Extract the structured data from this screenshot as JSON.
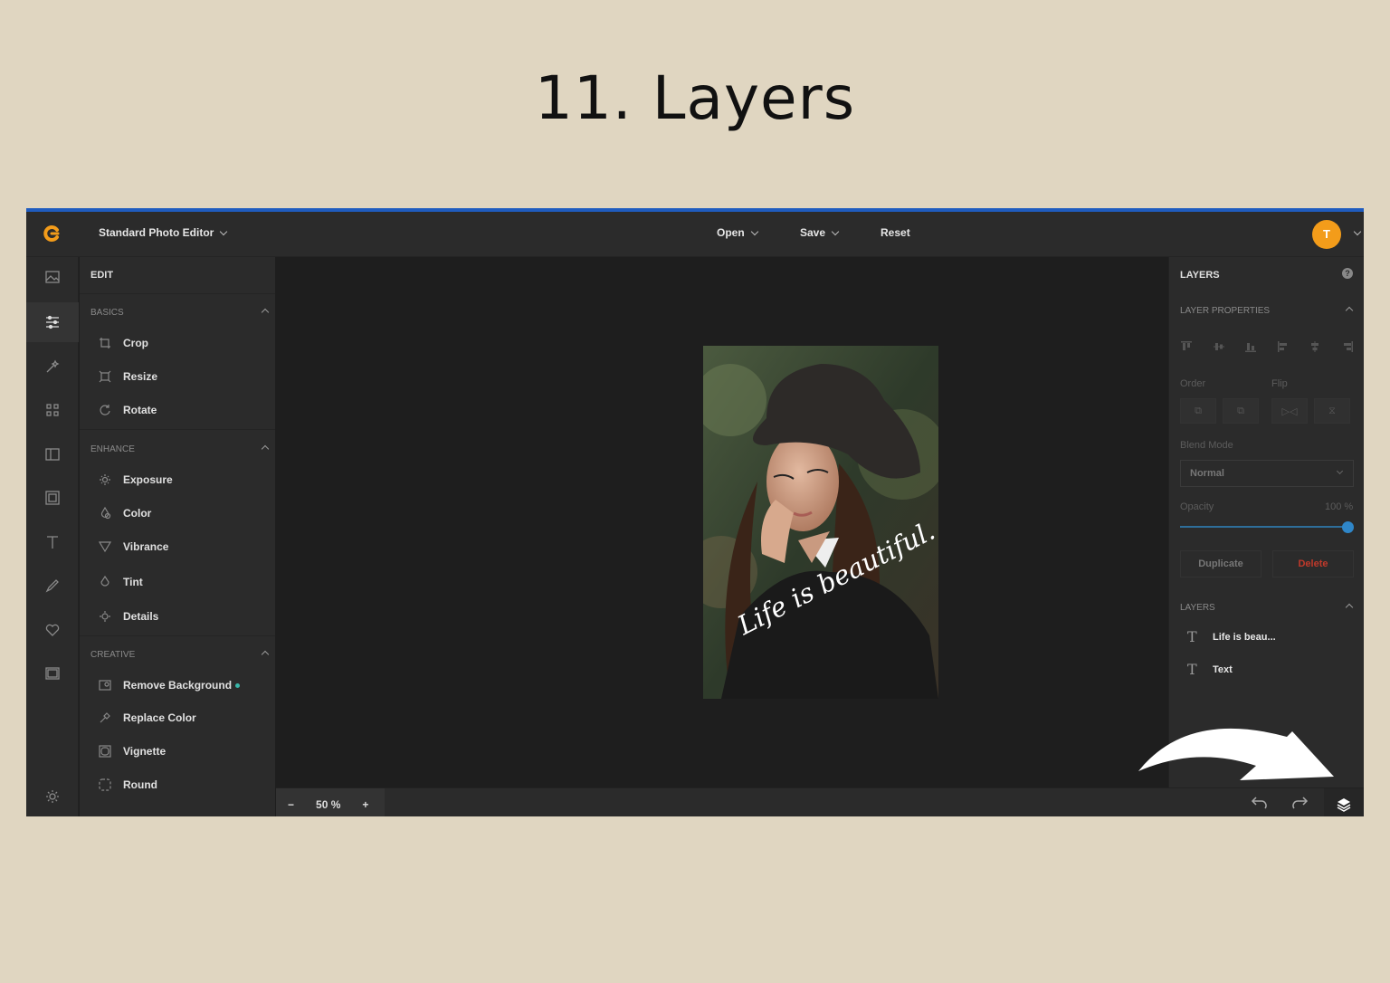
{
  "heading": "11. Layers",
  "topbar": {
    "app_title": "Standard Photo Editor",
    "menu": [
      {
        "label": "Open"
      },
      {
        "label": "Save"
      },
      {
        "label": "Reset"
      }
    ],
    "avatar_initial": "T"
  },
  "left_panel": {
    "title": "EDIT",
    "sections": [
      {
        "title": "BASICS",
        "items": [
          {
            "label": "Crop",
            "icon": "crop-icon"
          },
          {
            "label": "Resize",
            "icon": "resize-icon"
          },
          {
            "label": "Rotate",
            "icon": "rotate-icon"
          }
        ]
      },
      {
        "title": "ENHANCE",
        "items": [
          {
            "label": "Exposure",
            "icon": "exposure-icon"
          },
          {
            "label": "Color",
            "icon": "color-icon"
          },
          {
            "label": "Vibrance",
            "icon": "vibrance-icon"
          },
          {
            "label": "Tint",
            "icon": "tint-icon"
          },
          {
            "label": "Details",
            "icon": "details-icon"
          }
        ]
      },
      {
        "title": "CREATIVE",
        "items": [
          {
            "label": "Remove Background",
            "icon": "remove-background-icon"
          },
          {
            "label": "Replace Color",
            "icon": "replace-color-icon"
          },
          {
            "label": "Vignette",
            "icon": "vignette-icon"
          },
          {
            "label": "Round",
            "icon": "round-icon"
          }
        ]
      }
    ]
  },
  "canvas": {
    "photo_caption": "Life is beautiful."
  },
  "bottom_bar": {
    "zoom_minus": "−",
    "zoom_value": "50 %",
    "zoom_plus": "+"
  },
  "right_panel": {
    "title": "LAYERS",
    "help": "?",
    "layer_properties_title": "LAYER PROPERTIES",
    "order_label": "Order",
    "flip_label": "Flip",
    "blend_mode_label": "Blend Mode",
    "blend_mode_value": "Normal",
    "opacity_label": "Opacity",
    "opacity_value": "100 %",
    "opacity": 1.0,
    "duplicate_label": "Duplicate",
    "delete_label": "Delete",
    "layers_title": "LAYERS",
    "layers": [
      {
        "label": "Life is beau..."
      },
      {
        "label": "Text"
      }
    ]
  },
  "colors": {
    "accent": "#1f5cbf",
    "avatar": "#f39c1a",
    "delete": "#c0392b",
    "slider": "#2f86c8"
  }
}
